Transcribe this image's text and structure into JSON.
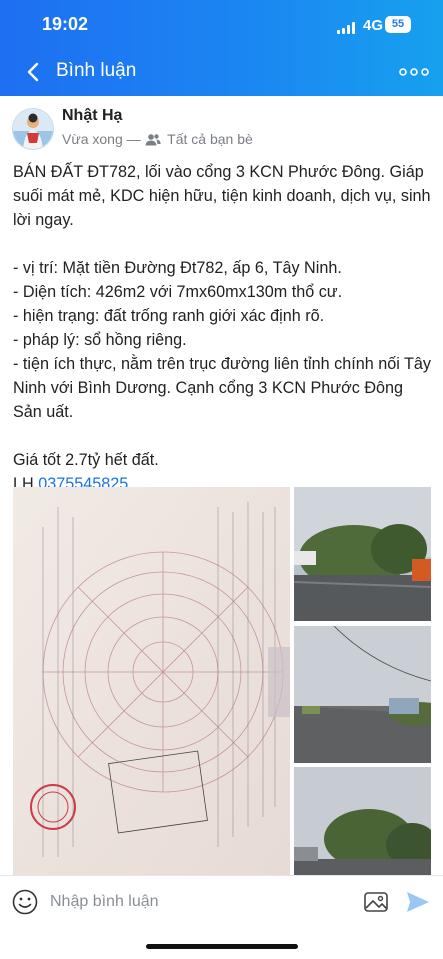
{
  "status_bar": {
    "time": "19:02",
    "network": "4G",
    "battery": "55"
  },
  "nav": {
    "title": "Bình luận",
    "back_icon": "chevron-left-icon",
    "more_icon": "more-horizontal-icon"
  },
  "post": {
    "author": "Nhật Hạ",
    "timestamp": "Vừa xong",
    "separator": "—",
    "audience": "Tất cả bạn bè",
    "intro": "BÁN ĐẤT ĐT782, lối vào cổng 3 KCN Phước Đông. Giáp suối mát mẻ, KDC hiện hữu, tiện kinh doanh, dịch vụ, sinh lời ngay.",
    "details": [
      "- vị trí: Mặt tiền Đường Đt782, ấp 6, Tây Ninh.",
      "- Diện tích: 426m2 với 7mx60mx130m thổ cư.",
      "- hiện trạng: đất trống ranh giới xác định rõ.",
      "- pháp lý: sổ hồng riêng.",
      "- tiện ích thực, nằm trên trục đường liên tỉnh chính nối Tây Ninh với Bình Dương. Cạnh cổng 3 KCN Phước Đông Sản uất."
    ],
    "price": "Giá tốt 2.7tỷ hết đất.",
    "contact_prefix": "LH ",
    "phone": "0375545825"
  },
  "comment_bar": {
    "placeholder": "Nhập bình luận",
    "emoji_icon": "emoji-icon",
    "image_icon": "image-icon",
    "send_icon": "send-icon"
  },
  "colors": {
    "header_start": "#1e6ff1",
    "header_end": "#16a1ee",
    "link": "#1a73e8",
    "muted": "#7a7f85"
  }
}
